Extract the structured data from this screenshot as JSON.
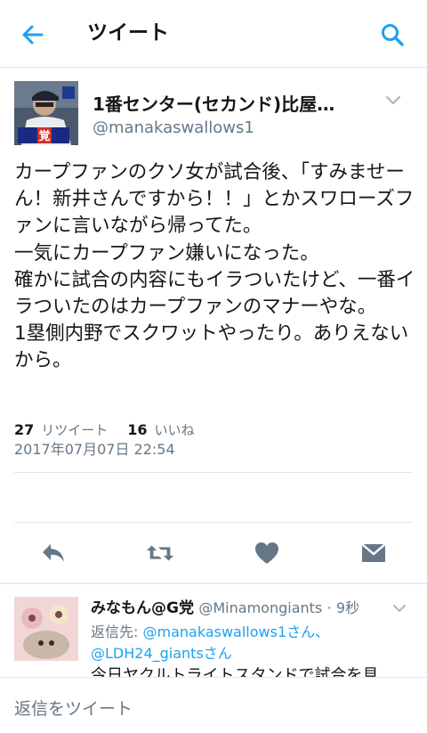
{
  "header": {
    "title": "ツイート",
    "back_icon": "arrow-left-icon",
    "search_icon": "search-icon",
    "accent": "#1da1f2"
  },
  "tweet": {
    "author_name": "1番センター(セカンド)比屋…",
    "author_handle": "@manakaswallows1",
    "avatar_caption": "覚",
    "text": "カープファンのクソ女が試合後、「すみませーん！新井さんですから！！」とかスワローズファンに言いながら帰ってた。\n一気にカープファン嫌いになった。\n確かに試合の内容にもイラついたけど、一番イラついたのはカープファンのマナーやな。\n1塁側内野でスクワットやったり。ありえないから。",
    "timestamp": "2017年07月07日 22:54",
    "retweet_count": "27",
    "retweet_label": "リツイート",
    "like_count": "16",
    "like_label": "いいね"
  },
  "actions": {
    "reply_icon": "reply-icon",
    "retweet_icon": "retweet-icon",
    "like_icon": "heart-icon",
    "dm_icon": "envelope-icon"
  },
  "reply": {
    "name": "みなもん@G党",
    "handle": "@Minamongiants",
    "time": "· 9秒",
    "reply_to_label": "返信先:",
    "reply_to_1": "@manakaswallows1さん、",
    "reply_to_2": "@LDH24_giantsさん",
    "text_partial": "今日ヤクルトライトスタンドで試合を見"
  },
  "compose": {
    "placeholder": "返信をツイート"
  }
}
